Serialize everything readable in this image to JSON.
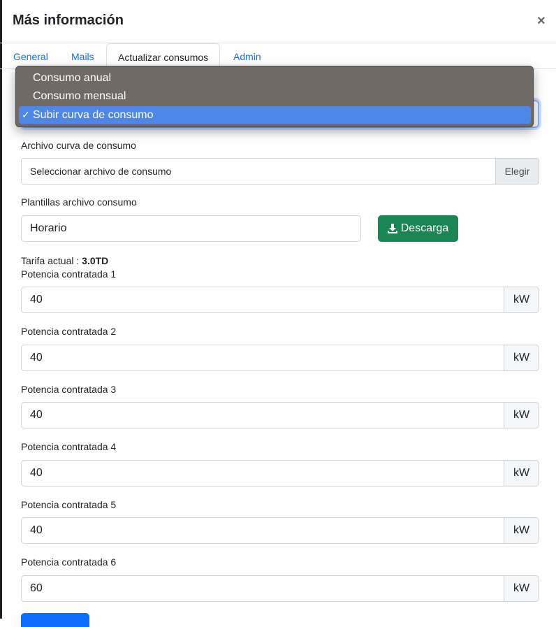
{
  "modal": {
    "title": "Más información",
    "close": "×"
  },
  "tabs": [
    {
      "label": "General"
    },
    {
      "label": "Mails"
    },
    {
      "label": "Actualizar consumos"
    },
    {
      "label": "Admin"
    }
  ],
  "consumption_type": {
    "options": [
      "Consumo anual",
      "Consumo mensual",
      "Subir curva de consumo"
    ],
    "selected": "Subir curva de consumo",
    "check_glyph": "✓"
  },
  "file": {
    "label": "Archivo curva de consumo",
    "placeholder": "Seleccionar archivo de consumo",
    "button": "Elegir"
  },
  "templates": {
    "label": "Plantillas archivo consumo",
    "value": "Horario",
    "download_label": "Descarga",
    "download_icon": "download-icon"
  },
  "tariff": {
    "label": "Tarifa actual :",
    "value": "3.0TD"
  },
  "powers": [
    {
      "label": "Potencia contratada 1",
      "value": "40",
      "unit": "kW"
    },
    {
      "label": "Potencia contratada 2",
      "value": "40",
      "unit": "kW"
    },
    {
      "label": "Potencia contratada 3",
      "value": "40",
      "unit": "kW"
    },
    {
      "label": "Potencia contratada 4",
      "value": "40",
      "unit": "kW"
    },
    {
      "label": "Potencia contratada 5",
      "value": "40",
      "unit": "kW"
    },
    {
      "label": "Potencia contratada 6",
      "value": "60",
      "unit": "kW"
    }
  ],
  "colors": {
    "accent": "#0d6efd",
    "success": "#198754",
    "dropdown_bg": "#6f6a66",
    "highlight": "#4f87e8"
  }
}
